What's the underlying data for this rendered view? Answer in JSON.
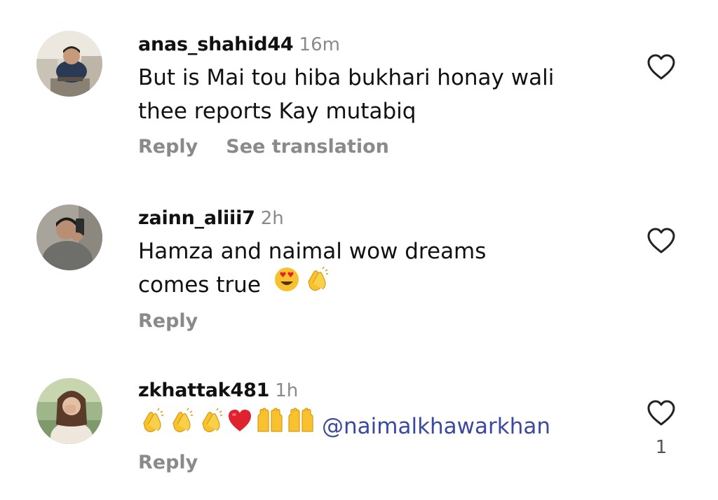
{
  "comments": [
    {
      "username": "anas_shahid44",
      "time": "16m",
      "text_lines": [
        "But is Mai tou hiba bukhari honay wali",
        "thee reports Kay mutabiq"
      ],
      "actions": [
        "Reply",
        "See translation"
      ],
      "avatar_icon": "profile-photo-man-at-desk",
      "like_icon": "heart-outline-icon"
    },
    {
      "username": "zainn_aliii7",
      "time": "2h",
      "text_lines": [
        "Hamza and naimal wow dreams",
        "comes true"
      ],
      "emojis": [
        "heart-eyes-emoji",
        "clapping-hands-emoji"
      ],
      "actions": [
        "Reply"
      ],
      "avatar_icon": "profile-photo-mirror-selfie",
      "like_icon": "heart-outline-icon"
    },
    {
      "username": "zkhattak481",
      "time": "1h",
      "emojis": [
        "clapping-hands-emoji",
        "clapping-hands-emoji",
        "clapping-hands-emoji",
        "red-heart-emoji",
        "raising-hands-emoji",
        "raising-hands-emoji"
      ],
      "mention": "@naimalkhawarkhan",
      "actions": [
        "Reply"
      ],
      "like_count": "1",
      "avatar_icon": "profile-photo-woman",
      "like_icon": "heart-outline-icon"
    }
  ],
  "colors": {
    "text": "#111111",
    "muted": "#8a8a8a",
    "mention": "#3b4a9e",
    "heart_emoji": "#e0212e",
    "emoji_yellow": "#f7c22e"
  }
}
